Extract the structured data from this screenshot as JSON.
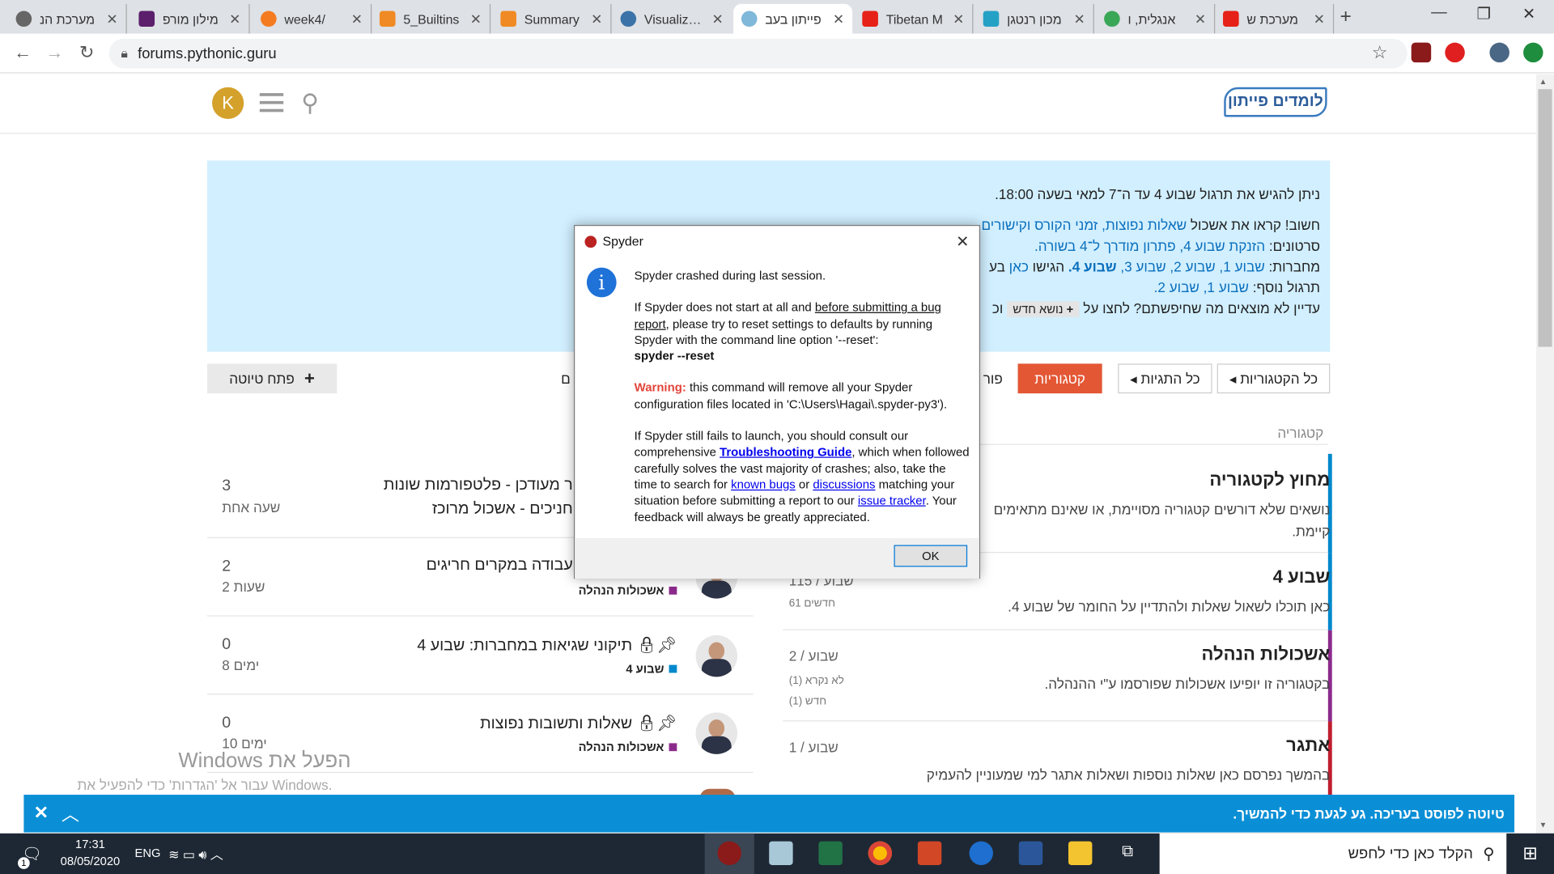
{
  "browser": {
    "tabs": [
      {
        "label": "מערכת הנ"
      },
      {
        "label": "מילון מורפ"
      },
      {
        "label": "week4/"
      },
      {
        "label": "5_Builtins"
      },
      {
        "label": "Summary"
      },
      {
        "label": "Visualize P"
      },
      {
        "label": "פייתון בעב"
      },
      {
        "label": "Tibetan M"
      },
      {
        "label": "מכון רנטגן"
      },
      {
        "label": "אנגלית, ו"
      },
      {
        "label": "מערכת ש"
      }
    ],
    "url": "forums.pythonic.guru"
  },
  "site": {
    "avatar_letter": "K",
    "logo_text": "לומדים פייתון",
    "banner": {
      "line1": "ניתן להגיש את תרגול שבוע 4 עד ה־7 למאי בשעה 18:00.",
      "line2_a": "חשוב! קראו את אשכול ",
      "line2_b": "שאלות נפוצות, זמני הקורס וקישורים",
      "line3_a": "סרטונים: ",
      "line3_b": "הזנקת שבוע 4, פתרון מודרך ל־4 בשורה.",
      "line4_a": "מחברות: ",
      "line4_b": "שבוע 1, שבוע 2, שבוע 3, ",
      "line4_c": "שבוע 4.",
      "line4_d": " הגישו ",
      "line4_e": "כאן",
      "line4_f": " בע",
      "line5_a": "תרגול נוסף: ",
      "line5_b": "שבוע 1, שבוע 2.",
      "line6_a": "עדיין לא מוצאים מה שחיפשתם? לחצו על ",
      "line6_chip": "נושא חדש",
      "line6_b": " וכ"
    },
    "nav": {
      "all_categories": "כל הקטגוריות",
      "all_tags": "כל התגיות",
      "categories": "קטגוריות",
      "partial_tab": "פור",
      "partial_left": "ם",
      "draft": "פתח טיוטה"
    },
    "category_header": "קטגוריה",
    "categories": [
      {
        "title": "מחוץ לקטגוריה",
        "desc": "נושאים שלא דורשים קטגוריה מסויימת, או שאינם מתאימים",
        "desc2": "קיימת."
      },
      {
        "title": "שבוע 4",
        "desc": "כאן תוכלו לשאול שאלות ולהתדיין על החומר של שבוע 4.",
        "stat": "115 / שבוע",
        "small": "61 חדשים"
      },
      {
        "title": "אשכולות הנהלה",
        "desc": "בקטגוריה זו יופיעו אשכולות שפורסמו ע\"י ההנהלה.",
        "stat": "2 / שבוע",
        "small1": "לא נקרא (1)",
        "small2": "חדש (1)"
      },
      {
        "title": "אתגר",
        "desc": "בהמשך נפרסם כאן שאלות נוספות ושאלות אתגר למי שמעוניין להעמיק",
        "stat": "1 / שבוע"
      }
    ],
    "topics": [
      {
        "title1": "ר מעודכן - פלטפורמות שונות",
        "title2": "חניכים - אשכול מרוכז",
        "replies": "3",
        "ago": "שעה אחת"
      },
      {
        "title1": "עבודה במקרים חריגים",
        "category": "אשכולות הנהלה",
        "replies": "2",
        "ago": "2 שעות"
      },
      {
        "title1": "תיקוני שגיאות במחברות: שבוע 4",
        "category": "שבוע 4",
        "replies": "0",
        "ago": "8 ימים"
      },
      {
        "title1": "שאלות ותשובות נפוצות",
        "category": "אשכולות הנהלה",
        "replies": "0",
        "ago": "10 ימים"
      }
    ],
    "draft_bar": "טיוטה לפוסט בעריכה. גע לגעת כדי להמשיך."
  },
  "watermark": {
    "line1": "הפעל את Windows",
    "line2": "עבור אל 'הגדרות' כדי להפעיל את Windows."
  },
  "dialog": {
    "title": "Spyder",
    "p1": "Spyder crashed during last session.",
    "p2_a": "If Spyder does not start at all and ",
    "p2_b": "before submitting a bug report",
    "p2_c": ", please try to reset settings to defaults by running Spyder with the command line option '--reset':",
    "p2_cmd": "spyder --reset",
    "p3_warn": "Warning:",
    "p3_text": " this command will remove all your Spyder configuration files located in 'C:\\Users\\Hagai\\.spyder-py3').",
    "p4_a": "If Spyder still fails to launch, you should consult our comprehensive ",
    "p4_link1": "Troubleshooting Guide",
    "p4_b": ", which when followed carefully solves the vast majority of crashes; also, take the time to search for ",
    "p4_link2": "known bugs",
    "p4_c": " or ",
    "p4_link3": "discussions",
    "p4_d": " matching your situation before submitting a report to our ",
    "p4_link4": "issue tracker",
    "p4_e": ". Your feedback will always be greatly appreciated.",
    "ok": "OK"
  },
  "taskbar": {
    "search_placeholder": "הקלד כאן כדי לחפש",
    "time": "17:31",
    "date": "08/05/2020",
    "lang": "ENG",
    "notif_count": "1"
  },
  "colors": {
    "banner_bg": "#d1efff",
    "accent_red": "#e45735",
    "link_blue": "#0a6fbd",
    "draft_bar": "#0a8fd6",
    "taskbar": "#1e2834"
  }
}
